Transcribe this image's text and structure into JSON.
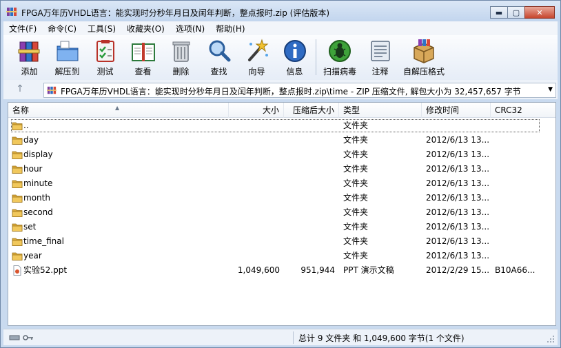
{
  "window": {
    "title": "FPGA万年历VHDL语言：能实现时分秒年月日及闰年判断，整点报时.zip (评估版本)",
    "controls": {
      "minimize": "▬",
      "maximize": "▢",
      "close": "✕"
    }
  },
  "menu": [
    "文件(F)",
    "命令(C)",
    "工具(S)",
    "收藏夹(O)",
    "选项(N)",
    "帮助(H)"
  ],
  "toolbar": [
    {
      "id": "add",
      "label": "添加",
      "icon": "books-add-icon"
    },
    {
      "id": "extract",
      "label": "解压到",
      "icon": "folder-extract-icon"
    },
    {
      "id": "test",
      "label": "测试",
      "icon": "clipboard-check-icon"
    },
    {
      "id": "view",
      "label": "查看",
      "icon": "open-book-icon"
    },
    {
      "id": "delete",
      "label": "删除",
      "icon": "trash-icon"
    },
    {
      "id": "find",
      "label": "查找",
      "icon": "magnifier-icon"
    },
    {
      "id": "wizard",
      "label": "向导",
      "icon": "magic-wand-icon"
    },
    {
      "id": "info",
      "label": "信息",
      "icon": "info-icon"
    },
    {
      "id": "virus",
      "label": "扫描病毒",
      "icon": "bug-icon"
    },
    {
      "id": "comment",
      "label": "注释",
      "icon": "notes-icon"
    },
    {
      "id": "sfx",
      "label": "自解压格式",
      "icon": "box-icon"
    }
  ],
  "address": {
    "up": "↑",
    "path": "FPGA万年历VHDL语言：能实现时分秒年月日及闰年判断，整点报时.zip\\time - ZIP 压缩文件, 解包大小为 32,457,657 字节",
    "dropdown": "▼"
  },
  "columns": {
    "name": "名称",
    "size": "大小",
    "packed": "压缩后大小",
    "type": "类型",
    "modified": "修改时间",
    "crc": "CRC32",
    "sort_indicator": "▲"
  },
  "rows": [
    {
      "name": "..",
      "size": "",
      "packed": "",
      "type": "文件夹",
      "modified": "",
      "crc": "",
      "kind": "folder"
    },
    {
      "name": "day",
      "size": "",
      "packed": "",
      "type": "文件夹",
      "modified": "2012/6/13 13...",
      "crc": "",
      "kind": "folder"
    },
    {
      "name": "display",
      "size": "",
      "packed": "",
      "type": "文件夹",
      "modified": "2012/6/13 13...",
      "crc": "",
      "kind": "folder"
    },
    {
      "name": "hour",
      "size": "",
      "packed": "",
      "type": "文件夹",
      "modified": "2012/6/13 13...",
      "crc": "",
      "kind": "folder"
    },
    {
      "name": "minute",
      "size": "",
      "packed": "",
      "type": "文件夹",
      "modified": "2012/6/13 13...",
      "crc": "",
      "kind": "folder"
    },
    {
      "name": "month",
      "size": "",
      "packed": "",
      "type": "文件夹",
      "modified": "2012/6/13 13...",
      "crc": "",
      "kind": "folder"
    },
    {
      "name": "second",
      "size": "",
      "packed": "",
      "type": "文件夹",
      "modified": "2012/6/13 13...",
      "crc": "",
      "kind": "folder"
    },
    {
      "name": "set",
      "size": "",
      "packed": "",
      "type": "文件夹",
      "modified": "2012/6/13 13...",
      "crc": "",
      "kind": "folder"
    },
    {
      "name": "time_final",
      "size": "",
      "packed": "",
      "type": "文件夹",
      "modified": "2012/6/13 13...",
      "crc": "",
      "kind": "folder"
    },
    {
      "name": "year",
      "size": "",
      "packed": "",
      "type": "文件夹",
      "modified": "2012/6/13 13...",
      "crc": "",
      "kind": "folder"
    },
    {
      "name": "实验52.ppt",
      "size": "1,049,600",
      "packed": "951,944",
      "type": "PPT 演示文稿",
      "modified": "2012/2/29 15...",
      "crc": "B10A66...",
      "kind": "ppt"
    }
  ],
  "status": {
    "summary": "总计 9 文件夹 和 1,049,600 字节(1 个文件)"
  },
  "colors": {
    "chrome": "#c9daef",
    "folder": "#e8b84a",
    "accent": "#2b5fae"
  }
}
